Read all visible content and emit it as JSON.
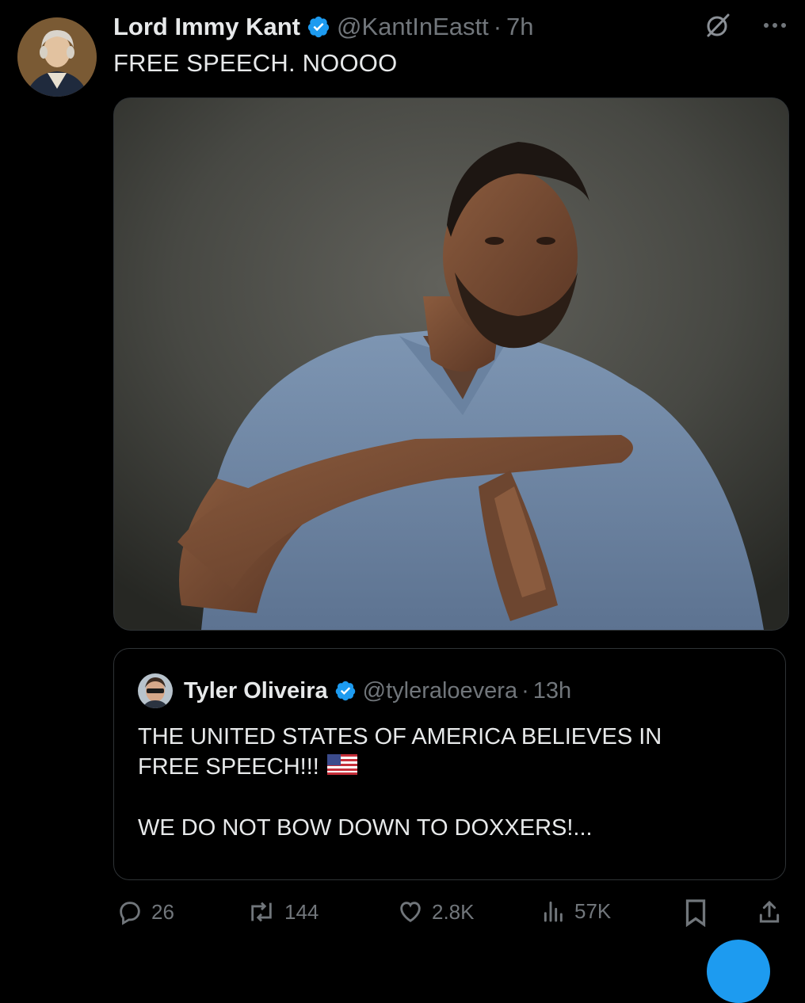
{
  "tweet": {
    "author_name": "Lord Immy Kant",
    "handle": "@KantInEastt",
    "separator": "·",
    "time": "7h",
    "text": "FREE SPEECH. NOOOO",
    "media_description_icon": "photo-of-man-making-timeout-gesture"
  },
  "icons": {
    "verified": "verified-badge-icon",
    "grok": "grok-icon",
    "more": "more-icon"
  },
  "quote": {
    "author_name": "Tyler Oliveira",
    "handle": "@tyleraloevera",
    "separator": "·",
    "time": "13h",
    "line1": "THE UNITED STATES OF AMERICA BELIEVES IN",
    "line2": "FREE SPEECH!!!",
    "line3": "WE DO NOT BOW DOWN TO DOXXERS!...",
    "flag_icon": "us-flag-icon"
  },
  "actions": {
    "replies": "26",
    "reposts": "144",
    "likes": "2.8K",
    "views": "57K"
  },
  "colors": {
    "background": "#000000",
    "text": "#e7e9ea",
    "muted": "#71767b",
    "accent": "#1d9bf0",
    "border": "#2f3336"
  }
}
